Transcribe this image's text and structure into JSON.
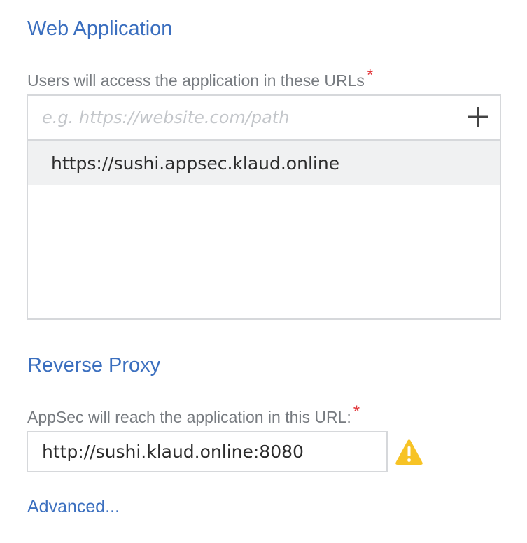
{
  "web_application": {
    "title": "Web Application",
    "urls_label": "Users will access the application in these URLs",
    "required_mark": "*",
    "url_input": {
      "placeholder": "e.g. https://website.com/path",
      "value": ""
    },
    "add_icon": "plus-icon",
    "urls": [
      "https://sushi.appsec.klaud.online"
    ]
  },
  "reverse_proxy": {
    "title": "Reverse Proxy",
    "url_label": "AppSec will reach the application in this URL:",
    "required_mark": "*",
    "url_value": "http://sushi.klaud.online:8080",
    "warning_icon": "warning-icon",
    "warning_color": "#f7c325"
  },
  "advanced_link": "Advanced...",
  "colors": {
    "title": "#3b6fbf",
    "label": "#777b80",
    "required": "#e2383c",
    "border": "#d6d8db",
    "row_bg": "#f0f1f2"
  }
}
